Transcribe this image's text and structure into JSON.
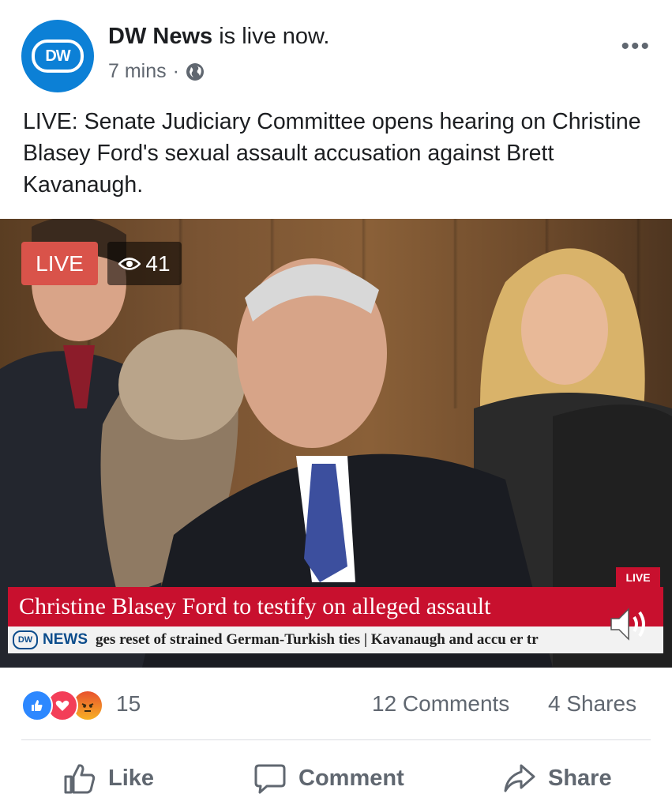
{
  "post": {
    "page_name": "DW News",
    "status_suffix": "is live now.",
    "time": "7 mins",
    "separator": "·",
    "avatar_text": "DW",
    "more_label": "•••",
    "text": "LIVE: Senate Judiciary Committee opens hearing on Christine Blasey Ford's sexual assault accusation against Brett Kavanaugh."
  },
  "video": {
    "live_badge": "LIVE",
    "viewer_count": "41",
    "tv_live_tag": "LIVE",
    "headline": "Christine Blasey Ford to testify on alleged assault",
    "ticker_logo": "DW",
    "ticker_brand": "NEWS",
    "ticker_text": "ges reset of strained German-Turkish ties | Kavanaugh and accu er tr"
  },
  "stats": {
    "reaction_count": "15",
    "comments": "12 Comments",
    "shares": "4 Shares",
    "reactions": [
      "like-icon",
      "love-icon",
      "angry-icon"
    ]
  },
  "actions": {
    "like": "Like",
    "comment": "Comment",
    "share": "Share"
  },
  "colors": {
    "dw_blue": "#0c80d6",
    "live_red": "#d9534a",
    "lower_third_red": "#c8102e",
    "meta_gray": "#606770"
  }
}
